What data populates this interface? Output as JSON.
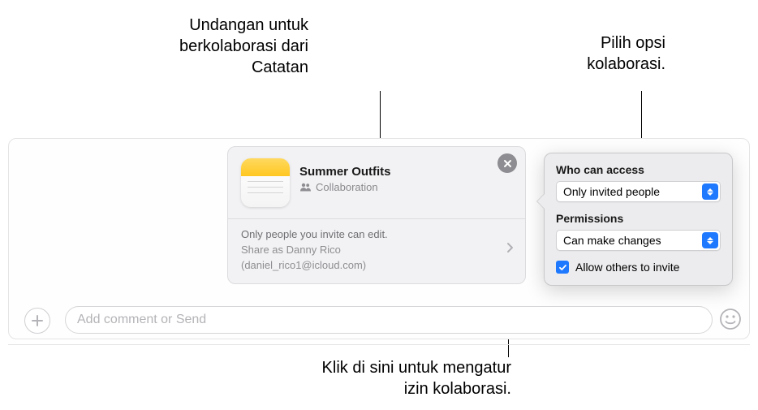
{
  "callouts": {
    "top_left": "Undangan untuk\nberkolaborasi dari\nCatatan",
    "top_right": "Pilih opsi\nkolaborasi.",
    "bottom": "Klik di sini untuk mengatur\nizin kolaborasi."
  },
  "invitation": {
    "title": "Summer Outfits",
    "subtitle": "Collaboration",
    "permission_line": "Only people you invite can edit.",
    "share_as_line": "Share as Danny Rico",
    "email_line": "(daniel_rico1@icloud.com)"
  },
  "popover": {
    "heading_access": "Who can access",
    "access_value": "Only invited people",
    "heading_permissions": "Permissions",
    "permissions_value": "Can make changes",
    "allow_others_label": "Allow others to invite",
    "allow_others_checked": true
  },
  "compose": {
    "placeholder": "Add comment or Send"
  },
  "colors": {
    "accent": "#1f79ff",
    "muted": "#8e8e92"
  }
}
